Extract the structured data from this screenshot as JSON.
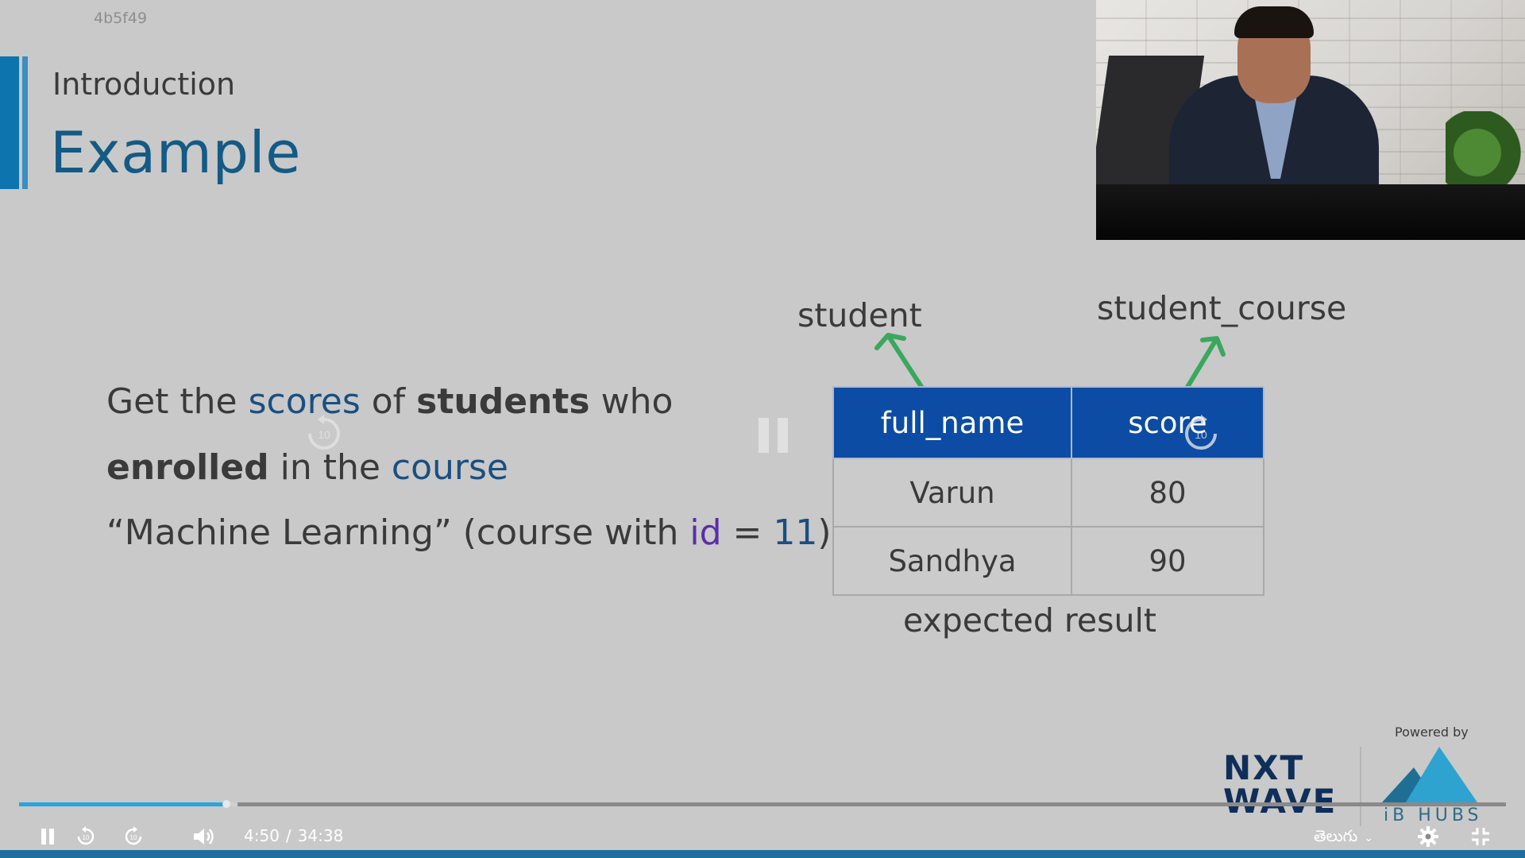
{
  "video": {
    "id_label": "4b5f49"
  },
  "slide": {
    "section": "Introduction",
    "title": "Example",
    "question": {
      "line1": {
        "t1": "Get the ",
        "t2": "scores",
        "t3": " of ",
        "t4": "students",
        "t5": " who"
      },
      "line2": {
        "t1": "enrolled",
        "t2": " in the ",
        "t3": "course"
      },
      "line3": {
        "t1": "“Machine Learning” (course with ",
        "t2": "id",
        "t3": " = ",
        "t4": "11",
        "t5": ")"
      }
    },
    "table": {
      "source_left": "student",
      "source_right": "student_course",
      "headers": [
        "full_name",
        "score"
      ],
      "rows": [
        [
          "Varun",
          "80"
        ],
        [
          "Sandhya",
          "90"
        ]
      ],
      "caption": "expected result"
    },
    "colors": {
      "header_bg": "#0c4ca4",
      "keyword_blue": "#1a4f80",
      "keyword_purple": "#5a2fa8",
      "arrow_green": "#3aa85c",
      "title_blue": "#135b85"
    }
  },
  "branding": {
    "powered_by": "Powered by",
    "nxt_line1": "NXT",
    "nxt_line2": "WAVE",
    "ibhubs": "iB HUBS"
  },
  "player": {
    "current_time": "4:50",
    "separator": "/",
    "duration": "34:38",
    "progress_fraction": 0.1395,
    "buffered_fraction": 0.147,
    "language": "తెలుగు",
    "accent": "#27a4dc",
    "icons": [
      "pause-icon",
      "rewind-10-icon",
      "forward-10-icon",
      "volume-icon",
      "chevron-down-icon",
      "gear-icon",
      "exit-fullscreen-icon"
    ]
  }
}
